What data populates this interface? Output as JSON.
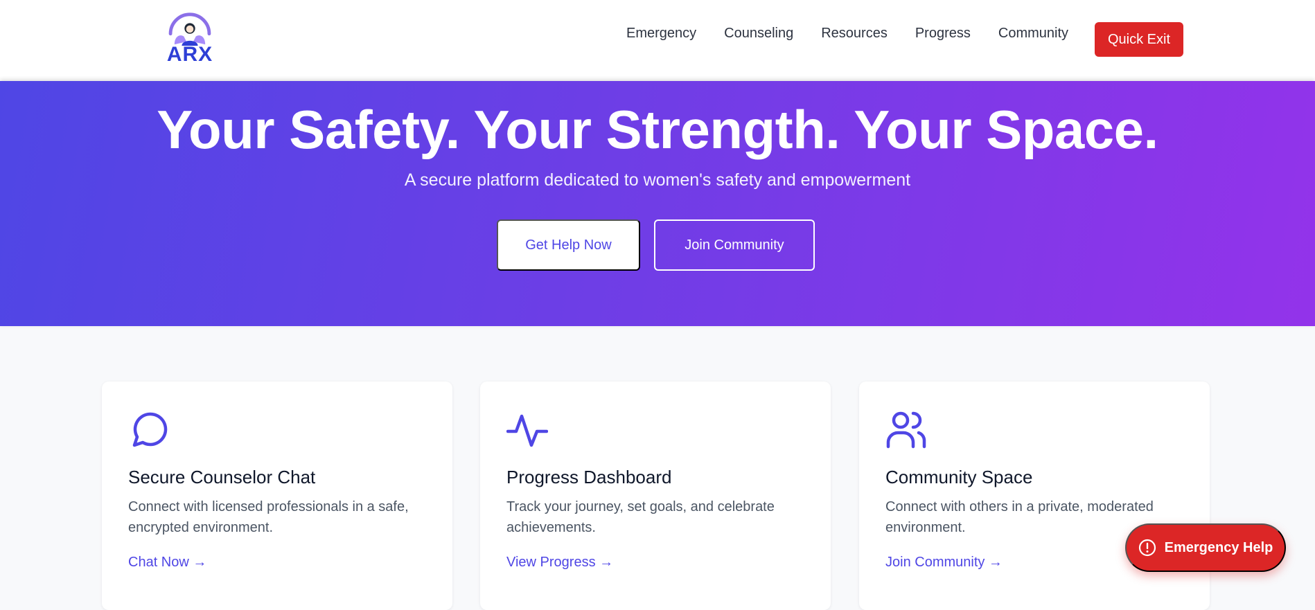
{
  "brand": {
    "name": "ARX",
    "accent": "#2e3fd6"
  },
  "nav": {
    "items": [
      "Emergency",
      "Counseling",
      "Resources",
      "Progress",
      "Community"
    ],
    "quick_exit": "Quick Exit"
  },
  "hero": {
    "title": "Your Safety. Your Strength. Your Space.",
    "subtitle": "A secure platform dedicated to women's safety and empowerment",
    "primary_cta": "Get Help Now",
    "secondary_cta": "Join Community"
  },
  "features": [
    {
      "icon": "chat-bubble-icon",
      "title": "Secure Counselor Chat",
      "description": "Connect with licensed professionals in a safe, encrypted environment.",
      "link": "Chat Now →"
    },
    {
      "icon": "activity-pulse-icon",
      "title": "Progress Dashboard",
      "description": "Track your journey, set goals, and celebrate achievements.",
      "link": "View Progress →"
    },
    {
      "icon": "users-icon",
      "title": "Community Space",
      "description": "Connect with others in a private, moderated environment.",
      "link": "Join Community →"
    }
  ],
  "floating": {
    "emergency_help": "Emergency Help"
  },
  "colors": {
    "primary": "#4f46e5",
    "hero_gradient_start": "#4f46e5",
    "hero_gradient_end": "#9333ea",
    "danger": "#dc2626"
  }
}
